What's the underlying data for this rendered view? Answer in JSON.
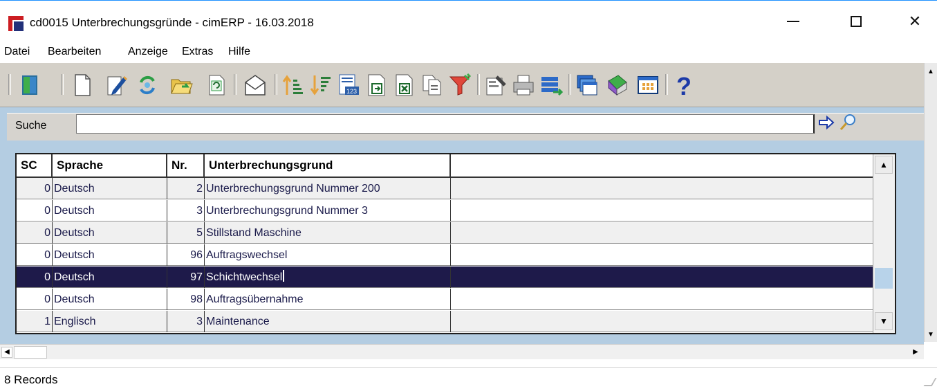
{
  "window": {
    "title": "cd0015 Unterbrechungsgründe - cimERP - 16.03.2018",
    "controls": {
      "minimize": "—",
      "maximize": "☐",
      "close": "✕"
    }
  },
  "menu": {
    "items": [
      "Datei",
      "Bearbeiten",
      "Anzeige",
      "Extras",
      "Hilfe"
    ]
  },
  "toolbar": {
    "icons": [
      "exit-door-icon",
      "new-document-icon",
      "edit-pencil-icon",
      "recycle-icon",
      "open-folder-icon",
      "refresh-icon",
      "mail-icon",
      "sort-ascending-icon",
      "sort-descending-icon",
      "numbered-list-icon",
      "export-document-icon",
      "excel-export-icon",
      "copy-documents-icon",
      "filter-funnel-icon",
      "properties-icon",
      "print-icon",
      "transfer-icon",
      "windows-icon",
      "book-icon",
      "calendar-grid-icon",
      "help-icon"
    ]
  },
  "search": {
    "label": "Suche",
    "value": "",
    "go_icon": "arrow-right-icon",
    "find_icon": "magnifier-icon"
  },
  "grid": {
    "columns": [
      "SC",
      "Sprache",
      "Nr.",
      "Unterbrechungsgrund",
      ""
    ],
    "rows": [
      {
        "sc": "0",
        "sprache": "Deutsch",
        "nr": "2",
        "grund": "Unterbrechungsgrund Nummer 200"
      },
      {
        "sc": "0",
        "sprache": "Deutsch",
        "nr": "3",
        "grund": "Unterbrechungsgrund Nummer 3"
      },
      {
        "sc": "0",
        "sprache": "Deutsch",
        "nr": "5",
        "grund": "Stillstand Maschine"
      },
      {
        "sc": "0",
        "sprache": "Deutsch",
        "nr": "96",
        "grund": "Auftragswechsel"
      },
      {
        "sc": "0",
        "sprache": "Deutsch",
        "nr": "97",
        "grund": "Schichtwechsel"
      },
      {
        "sc": "0",
        "sprache": "Deutsch",
        "nr": "98",
        "grund": "Auftragsübernahme"
      },
      {
        "sc": "1",
        "sprache": "Englisch",
        "nr": "3",
        "grund": "Maintenance"
      }
    ],
    "selected_row_index": 4
  },
  "status": {
    "records": "8 Records"
  },
  "colors": {
    "selection": "#1e1a4a",
    "workarea": "#b4cde2",
    "toolbar": "#d4d0c8",
    "logo_red": "#cc1d22",
    "logo_blue": "#22307a"
  }
}
